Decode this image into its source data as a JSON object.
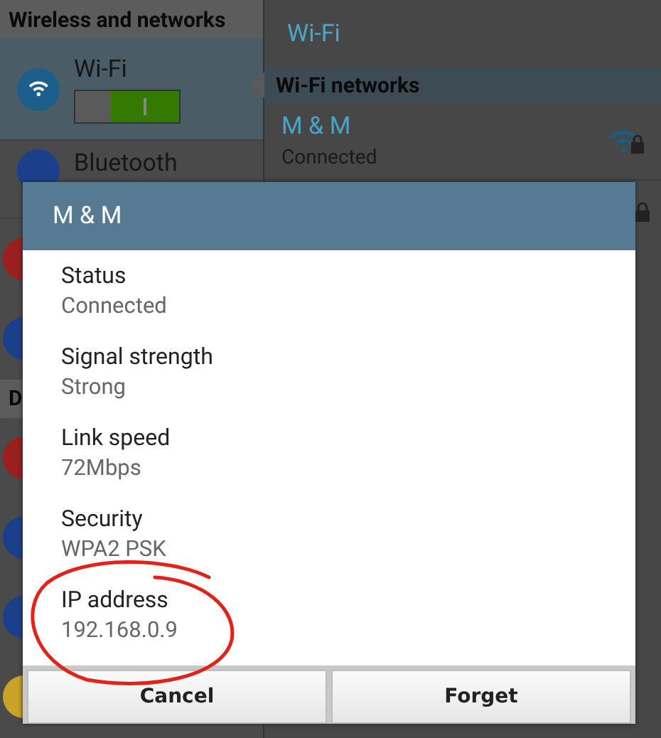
{
  "left_panel": {
    "header": "Wireless and networks",
    "items": [
      {
        "label": "Wi-Fi",
        "selected": true,
        "on": true,
        "color": "#1c5f8c"
      },
      {
        "label": "Bluetooth",
        "selected": false,
        "color": "#1c3f8c"
      },
      {
        "color": "#9c1f1f"
      },
      {
        "color": "#1c3f8c"
      }
    ],
    "section_2": {
      "header": "D",
      "items": [
        {
          "color": "#9c1f1f"
        },
        {
          "color": "#1c3f8c"
        },
        {
          "color": "#1c3f8c"
        },
        {
          "color": "#c9a227"
        }
      ]
    }
  },
  "right_panel": {
    "title": "Wi-Fi",
    "section": "Wi-Fi networks",
    "networks": [
      {
        "name": "M & M",
        "status": "Connected",
        "secured": true
      }
    ]
  },
  "dialog": {
    "title": "M & M",
    "fields": [
      {
        "label": "Status",
        "value": "Connected"
      },
      {
        "label": "Signal strength",
        "value": "Strong"
      },
      {
        "label": "Link speed",
        "value": "72Mbps"
      },
      {
        "label": "Security",
        "value": "WPA2 PSK"
      },
      {
        "label": "IP address",
        "value": "192.168.0.9",
        "circled": true
      }
    ],
    "buttons": [
      "Cancel",
      "Forget"
    ]
  }
}
